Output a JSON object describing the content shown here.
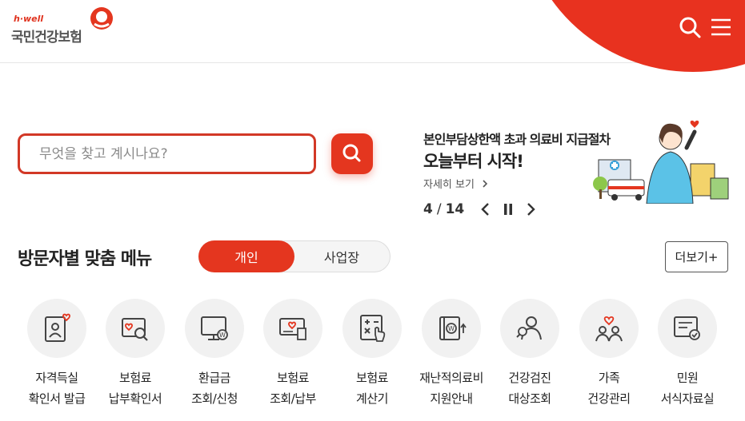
{
  "header": {
    "logo_sub": "h·well",
    "logo_main": "국민건강보험",
    "brand_color": "#e4361f",
    "icons": [
      "search-icon",
      "hamburger-menu-icon"
    ]
  },
  "search": {
    "placeholder": "무엇을 찾고 계시나요?",
    "button_icon": "search-icon"
  },
  "banner": {
    "line1": "본인부담상한액 초과 의료비 지급절차",
    "line2": "오늘부터 시작!",
    "more": "자세히 보기",
    "current": "4",
    "separator": "/",
    "total": "14",
    "controls": [
      "prev-icon",
      "pause-icon",
      "next-icon"
    ]
  },
  "section": {
    "title": "방문자별 맞춤 메뉴",
    "tab_active": "개인",
    "tab_inactive": "사업장",
    "more": "더보기+"
  },
  "menu": [
    {
      "line1": "자격득실",
      "line2": "확인서 발급",
      "icon": "id-card-heart-icon"
    },
    {
      "line1": "보험료",
      "line2": "납부확인서",
      "icon": "document-search-icon"
    },
    {
      "line1": "환급금",
      "line2": "조회/신청",
      "icon": "monitor-won-icon"
    },
    {
      "line1": "보험료",
      "line2": "조회/납부",
      "icon": "bill-heart-icon"
    },
    {
      "line1": "보험료",
      "line2": "계산기",
      "icon": "calculator-icon"
    },
    {
      "line1": "재난적의료비",
      "line2": "지원안내",
      "icon": "wallet-won-icon"
    },
    {
      "line1": "건강검진",
      "line2": "대상조회",
      "icon": "person-search-icon"
    },
    {
      "line1": "가족",
      "line2": "건강관리",
      "icon": "family-heart-icon"
    },
    {
      "line1": "민원",
      "line2": "서식자료실",
      "icon": "form-check-icon"
    }
  ]
}
